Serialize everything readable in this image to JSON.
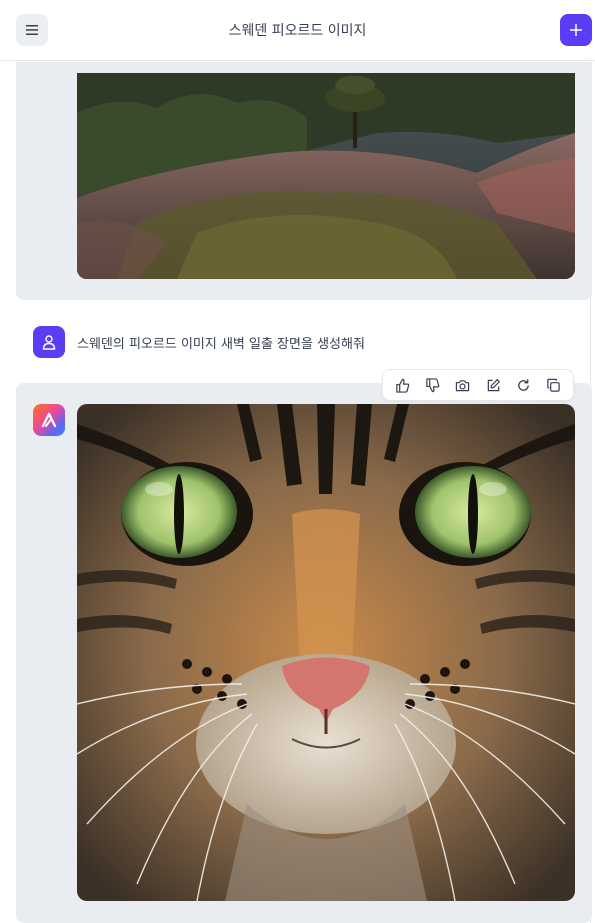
{
  "header": {
    "title": "스웨덴 피오르드 이미지",
    "menu_icon": "hamburger-menu-icon",
    "new_icon": "plus-icon"
  },
  "conversation": {
    "user_message": "스웨덴의 피오르드 이미지 새벽 일출 장면을 생성해줘",
    "user_avatar_icon": "user-icon",
    "bot_avatar_icon": "assistant-logo-icon"
  },
  "toolbar": {
    "actions": [
      "thumbs-up-icon",
      "thumbs-down-icon",
      "camera-icon",
      "edit-icon",
      "refresh-icon",
      "copy-icon"
    ]
  },
  "colors": {
    "accent": "#5b3df5",
    "panel": "#e9ecf1"
  }
}
